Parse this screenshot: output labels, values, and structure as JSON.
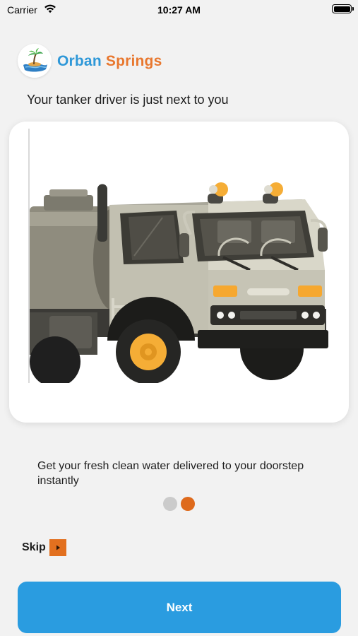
{
  "status_bar": {
    "carrier": "Carrier",
    "time": "10:27 AM"
  },
  "brand": {
    "name_part1": "Orban",
    "name_part2": "Springs",
    "color_part1": "#2f98d8",
    "color_part2": "#e8772e",
    "logo_icon": "palm-island-water-logo"
  },
  "onboarding": {
    "headline": "Your tanker driver is just next to you",
    "illustration": "tanker-truck-illustration",
    "description": "Get your fresh clean water delivered to your doorstep instantly",
    "page_count": 2,
    "active_page": 2,
    "dot_inactive_color": "#cbcbcb",
    "dot_active_color": "#de6a1c"
  },
  "actions": {
    "skip_label": "Skip",
    "skip_icon": "play-arrow-icon",
    "skip_icon_color": "#e2701f",
    "next_label": "Next",
    "next_color": "#2a9ce0"
  }
}
